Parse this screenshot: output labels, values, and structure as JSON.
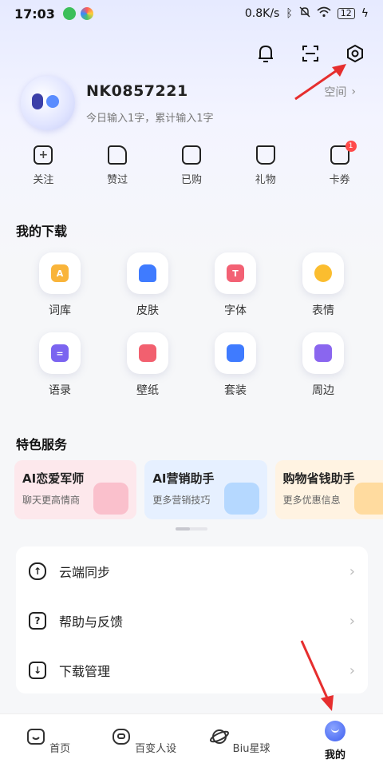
{
  "status_bar": {
    "time": "17:03",
    "net_speed": "0.8K/s",
    "battery": "12"
  },
  "profile": {
    "username": "NK0857221",
    "stats": "今日输入1字，累计输入1字",
    "space_label": "空间"
  },
  "quick_actions": [
    {
      "label": "关注",
      "icon": "plus-box-icon"
    },
    {
      "label": "赞过",
      "icon": "thumb-up-icon"
    },
    {
      "label": "已购",
      "icon": "shopping-bag-icon"
    },
    {
      "label": "礼物",
      "icon": "gift-icon"
    },
    {
      "label": "卡券",
      "icon": "coupon-icon",
      "badge": "1"
    }
  ],
  "downloads": {
    "title": "我的下载",
    "items": [
      {
        "label": "词库",
        "glyph": "A",
        "color": "#f9b43a"
      },
      {
        "label": "皮肤",
        "glyph": "",
        "color": "#3f7bff"
      },
      {
        "label": "字体",
        "glyph": "T",
        "color": "#f36174"
      },
      {
        "label": "表情",
        "glyph": "",
        "color": "#fbbd2f"
      },
      {
        "label": "语录",
        "glyph": "=",
        "color": "#7b64f0"
      },
      {
        "label": "壁纸",
        "glyph": "",
        "color": "#f2606f"
      },
      {
        "label": "套装",
        "glyph": "",
        "color": "#3f7bff"
      },
      {
        "label": "周边",
        "glyph": "",
        "color": "#8a66ef"
      }
    ]
  },
  "services": {
    "title": "特色服务",
    "cards": [
      {
        "title": "AI恋爱军师",
        "desc": "聊天更高情商",
        "bg": "#fde8ec",
        "art": "#f9b5c4"
      },
      {
        "title": "AI营销助手",
        "desc": "更多营销技巧",
        "bg": "#e6f0ff",
        "art": "#a9d2ff"
      },
      {
        "title": "购物省钱助手",
        "desc": "更多优惠信息",
        "bg": "#fff3e2",
        "art": "#ffd58f"
      }
    ]
  },
  "menu": [
    {
      "label": "云端同步",
      "icon": "cloud-sync-icon"
    },
    {
      "label": "帮助与反馈",
      "icon": "help-icon"
    },
    {
      "label": "下载管理",
      "icon": "download-icon"
    }
  ],
  "tabs": [
    {
      "label": "首页",
      "icon": "home-icon"
    },
    {
      "label": "百变人设",
      "icon": "persona-icon"
    },
    {
      "label": "Biu星球",
      "icon": "planet-icon"
    },
    {
      "label": "我的",
      "icon": "me-icon",
      "active": true
    }
  ],
  "colors": {
    "accent": "#3f5ff0",
    "annotation_arrow": "#e62e2e",
    "badge": "#ff4a4a"
  }
}
